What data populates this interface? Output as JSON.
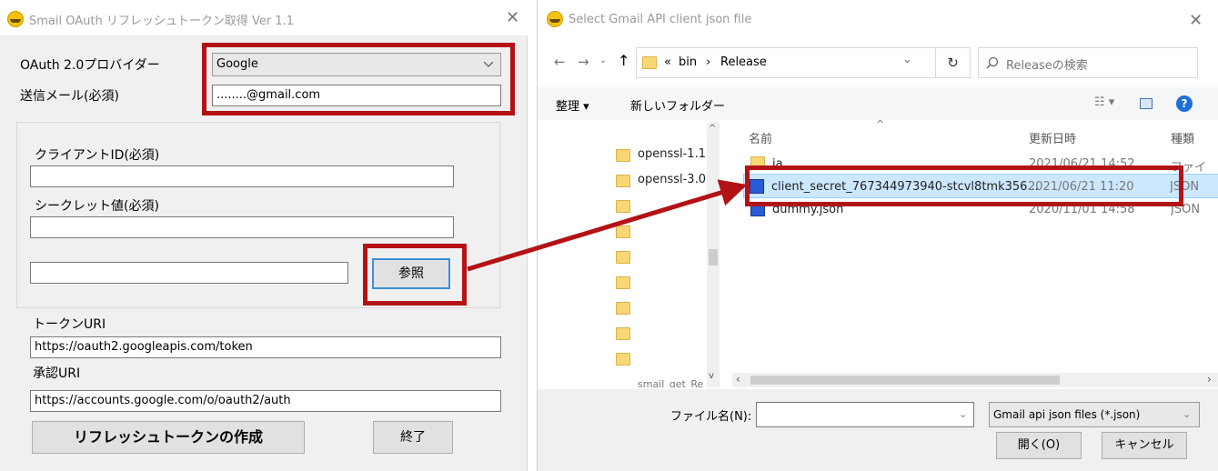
{
  "left_window": {
    "title": "Smail OAuth リフレッシュトークン取得 Ver 1.1",
    "close_glyph": "✕",
    "provider_label": "OAuth 2.0プロバイダー",
    "provider_value": "Google",
    "email_label": "送信メール(必須)",
    "email_value": "........@gmail.com",
    "client_id_label": "クライアントID(必須)",
    "client_id_value": "",
    "secret_label": "シークレット値(必須)",
    "secret_value": "",
    "json_path_value": "",
    "browse_button": "参照",
    "token_uri_label": "トークンURI",
    "token_uri_value": "https://oauth2.googleapis.com/token",
    "auth_uri_label": "承認URI",
    "auth_uri_value": "https://accounts.google.com/o/oauth2/auth",
    "create_button": "リフレッシュトークンの作成",
    "exit_button": "終了"
  },
  "right_window": {
    "title": "Select Gmail API client json file",
    "close_glyph": "✕",
    "breadcrumb": {
      "prefix": "«",
      "part1": "bin",
      "sep": "›",
      "part2": "Release"
    },
    "search_placeholder": "Releaseの検索",
    "organize": "整理 ▾",
    "new_folder": "新しいフォルダー",
    "tree_items": [
      "openssl-1.1.",
      "openssl-3.0.",
      "smail_get_Re"
    ],
    "columns": {
      "name": "名前",
      "date": "更新日時",
      "type": "種類"
    },
    "files": [
      {
        "name": "ja",
        "date": "2021/06/21 14:52",
        "type": "ファイル"
      },
      {
        "name": "client_secret_767344973940-stcvl8tmk356...",
        "date": "2021/06/21 11:20",
        "type": "JSON"
      },
      {
        "name": "dummy.json",
        "date": "2020/11/01 14:58",
        "type": "JSON"
      }
    ],
    "filename_label": "ファイル名(N):",
    "filename_value": "",
    "filter_value": "Gmail api json files (*.json)",
    "open_button": "開く(O)",
    "cancel_button": "キャンセル"
  },
  "colors": {
    "highlight_red": "#b31217",
    "selection": "#cce8ff",
    "folder": "#f8d775"
  }
}
